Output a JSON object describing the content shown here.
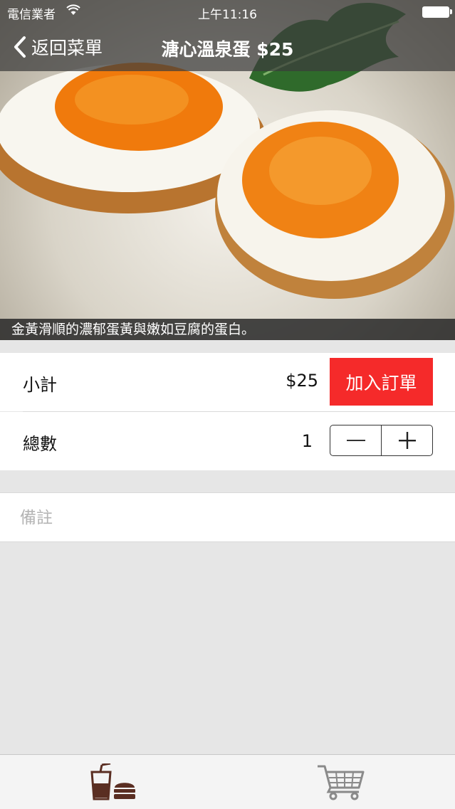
{
  "status_bar": {
    "carrier": "電信業者",
    "time": "上午11:16"
  },
  "nav": {
    "back_label": "返回菜單",
    "title": "溏心溫泉蛋 $25"
  },
  "hero": {
    "caption": "金黃滑順的濃郁蛋黃與嫩如豆腐的蛋白。"
  },
  "order": {
    "subtotal_label": "小計",
    "subtotal_value": "$25",
    "add_button_label": "加入訂單",
    "quantity_label": "總數",
    "quantity_value": "1"
  },
  "note": {
    "placeholder": "備註"
  },
  "tabbar": {
    "tabs": [
      {
        "icon": "drink-burger-icon"
      },
      {
        "icon": "shopping-cart-icon"
      }
    ]
  },
  "colors": {
    "accent": "#f52a2a",
    "icon_brown": "#5a2e22"
  }
}
